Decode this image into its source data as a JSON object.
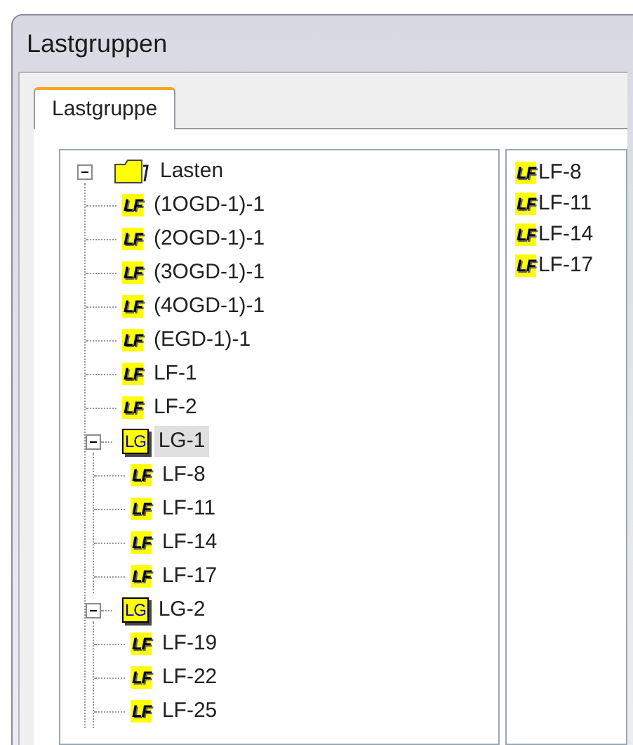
{
  "window": {
    "title": "Lastgruppen"
  },
  "tabs": [
    {
      "label": "Lastgruppe",
      "selected": true
    }
  ],
  "tree": [
    {
      "kind": "folder",
      "label": "Lasten",
      "expanded": true,
      "selected": false,
      "children": [
        {
          "kind": "load",
          "icon_label": "LF",
          "label": "(1OGD-1)-1",
          "selected": false
        },
        {
          "kind": "load",
          "icon_label": "LF",
          "label": "(2OGD-1)-1",
          "selected": false
        },
        {
          "kind": "load",
          "icon_label": "LF",
          "label": "(3OGD-1)-1",
          "selected": false
        },
        {
          "kind": "load",
          "icon_label": "LF",
          "label": "(4OGD-1)-1",
          "selected": false
        },
        {
          "kind": "load",
          "icon_label": "LF",
          "label": "(EGD-1)-1",
          "selected": false
        },
        {
          "kind": "load",
          "icon_label": "LF",
          "label": "LF-1",
          "selected": false
        },
        {
          "kind": "load",
          "icon_label": "LF",
          "label": "LF-2",
          "selected": false
        },
        {
          "kind": "group",
          "icon_label": "LG",
          "label": "LG-1",
          "expanded": true,
          "selected": true,
          "children": [
            {
              "kind": "load",
              "icon_label": "LF",
              "label": "LF-8",
              "selected": false
            },
            {
              "kind": "load",
              "icon_label": "LF",
              "label": "LF-11",
              "selected": false
            },
            {
              "kind": "load",
              "icon_label": "LF",
              "label": "LF-14",
              "selected": false
            },
            {
              "kind": "load",
              "icon_label": "LF",
              "label": "LF-17",
              "selected": false
            }
          ]
        },
        {
          "kind": "group",
          "icon_label": "LG",
          "label": "LG-2",
          "expanded": true,
          "selected": false,
          "children": [
            {
              "kind": "load",
              "icon_label": "LF",
              "label": "LF-19",
              "selected": false
            },
            {
              "kind": "load",
              "icon_label": "LF",
              "label": "LF-22",
              "selected": false
            },
            {
              "kind": "load",
              "icon_label": "LF",
              "label": "LF-25",
              "selected": false
            }
          ]
        }
      ]
    }
  ],
  "list": [
    {
      "icon_label": "LF",
      "label": "LF-8"
    },
    {
      "icon_label": "LF",
      "label": "LF-11"
    },
    {
      "icon_label": "LF",
      "label": "LF-14"
    },
    {
      "icon_label": "LF",
      "label": "LF-17"
    }
  ]
}
